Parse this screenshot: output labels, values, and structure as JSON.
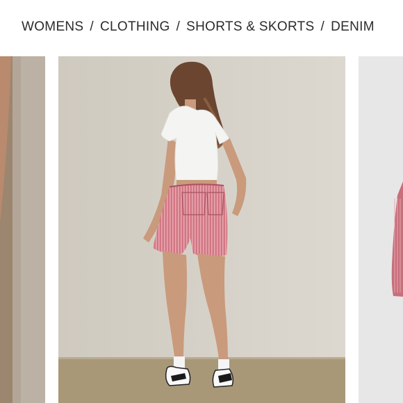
{
  "breadcrumb": {
    "items": [
      "WOMENS",
      "CLOTHING",
      "SHORTS & SKORTS",
      "DENIM"
    ],
    "separator": "/"
  },
  "gallery": {
    "colors": {
      "wall": "#d6d2c9",
      "floor": "#a89878",
      "shorts": "#d0737f",
      "top": "#f4f4f2",
      "hair": "#6b4530",
      "skin": "#c99a7c"
    }
  }
}
